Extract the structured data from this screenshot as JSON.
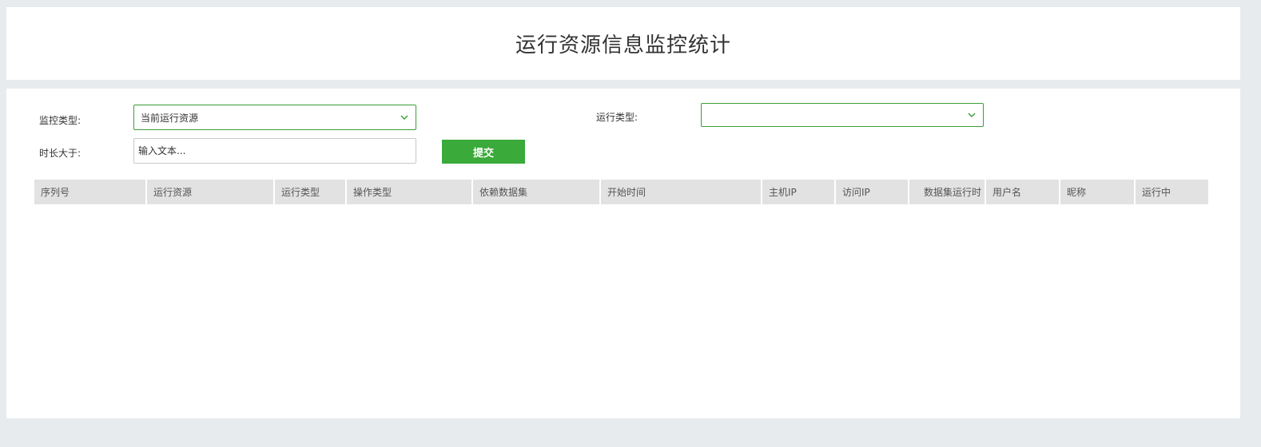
{
  "header": {
    "title": "运行资源信息监控统计"
  },
  "filters": {
    "monitor_type_label": "监控类型:",
    "monitor_type_value": "当前运行资源",
    "run_type_label": "运行类型:",
    "run_type_value": "",
    "duration_label": "时长大于:",
    "duration_placeholder": "输入文本...",
    "submit_label": "提交"
  },
  "table": {
    "columns": [
      "序列号",
      "运行资源",
      "运行类型",
      "操作类型",
      "依赖数据集",
      "开始时间",
      "主机IP",
      "访问IP",
      "数据集运行时",
      "用户名",
      "昵称",
      "运行中"
    ],
    "rows": []
  },
  "colors": {
    "accent": "#3aaa3a",
    "border_accent": "#3a9e3a",
    "header_bg": "#e2e2e2",
    "page_bg": "#e8ebee"
  },
  "icons": {
    "dropdown": "chevron-down-icon"
  }
}
